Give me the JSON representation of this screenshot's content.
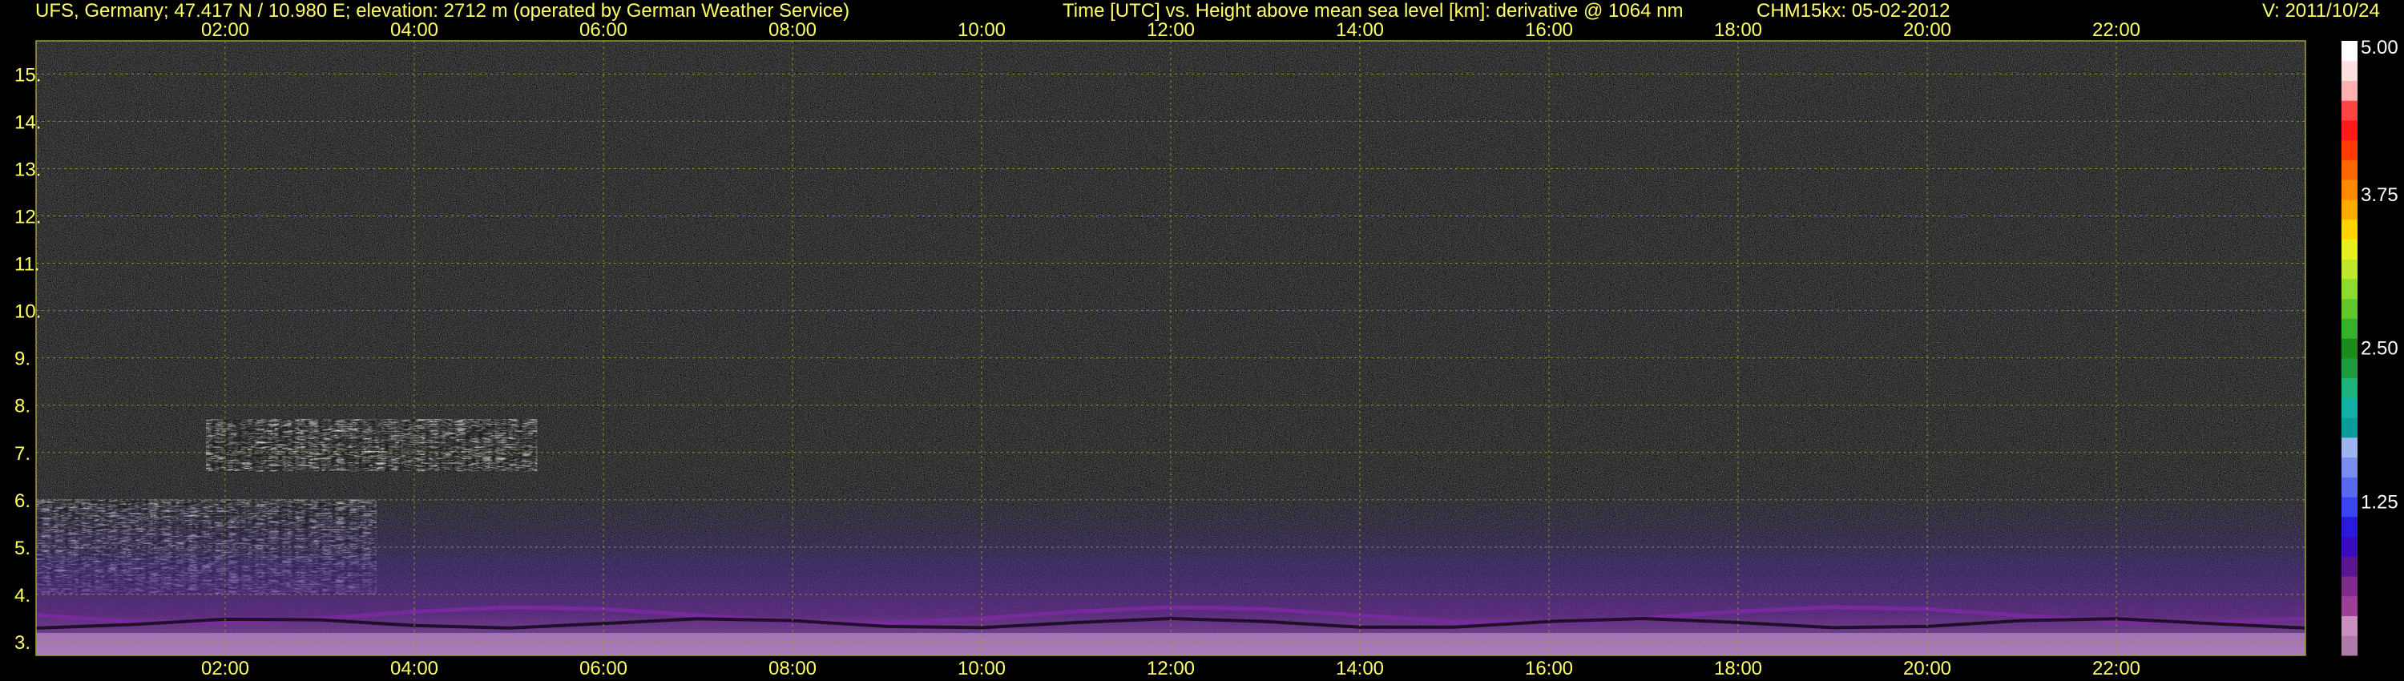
{
  "header": {
    "station": "UFS, Germany; 47.417 N / 10.980 E; elevation: 2712 m  (operated by German Weather Service)",
    "title": "Time [UTC] vs. Height above mean sea level [km]: derivative @ 1064 nm",
    "instrument": "CHM15kx: 05-02-2012",
    "version": "V: 2011/10/24"
  },
  "colors": {
    "text": "#ffff66",
    "grid": "#a0a030",
    "background": "#000000"
  },
  "chart_data": {
    "type": "heatmap",
    "title": "Time [UTC] vs. Height above mean sea level [km]: derivative @ 1064 nm",
    "xlabel": "Time [UTC]",
    "ylabel": "Height above mean sea level [km]",
    "x_ticks": [
      "02:00",
      "04:00",
      "06:00",
      "08:00",
      "10:00",
      "12:00",
      "14:00",
      "16:00",
      "18:00",
      "20:00",
      "22:00"
    ],
    "x_tick_hours": [
      2,
      4,
      6,
      8,
      10,
      12,
      14,
      16,
      18,
      20,
      22
    ],
    "xlim_hours": [
      0,
      24
    ],
    "y_ticks": [
      "3.",
      "4.",
      "5.",
      "6.",
      "7.",
      "8.",
      "9.",
      "10.",
      "11.",
      "12.",
      "13.",
      "14.",
      "15."
    ],
    "y_tick_values": [
      3,
      4,
      5,
      6,
      7,
      8,
      9,
      10,
      11,
      12,
      13,
      14,
      15
    ],
    "ylim_km": [
      2.712,
      15.7
    ],
    "grid": true,
    "colorbar": {
      "range": [
        0,
        5.0
      ],
      "labels": [
        "5.00",
        "3.75",
        "2.50",
        "1.25"
      ],
      "label_values": [
        5.0,
        3.75,
        2.5,
        1.25
      ],
      "colors": [
        "#b07aa8",
        "#c990c0",
        "#9d3f96",
        "#7f2a8d",
        "#5a1690",
        "#3a0cc0",
        "#2a1ae0",
        "#3a44f0",
        "#5a6af0",
        "#7a8ef0",
        "#9db3f2",
        "#0b9b9b",
        "#14b2a6",
        "#1db37a",
        "#1d9a3c",
        "#1a8a1a",
        "#36b22a",
        "#60c82a",
        "#8cdc30",
        "#c0e82a",
        "#e8f020",
        "#ffd400",
        "#ffaa00",
        "#ff8a00",
        "#ff6600",
        "#ff3a00",
        "#ff1a1a",
        "#ff4444",
        "#ffb0b0",
        "#ffe0e0",
        "#ffffff"
      ]
    },
    "features": [
      {
        "name": "cloud",
        "start_h": 0.0,
        "end_h": 3.6,
        "bottom_km": 4.0,
        "top_km": 6.0
      },
      {
        "name": "cloud",
        "start_h": 1.8,
        "end_h": 5.3,
        "bottom_km": 6.6,
        "top_km": 7.7
      },
      {
        "name": "boundary-layer",
        "start_h": 0.0,
        "end_h": 24.0,
        "bottom_km": 2.712,
        "top_km": 3.9
      }
    ]
  }
}
